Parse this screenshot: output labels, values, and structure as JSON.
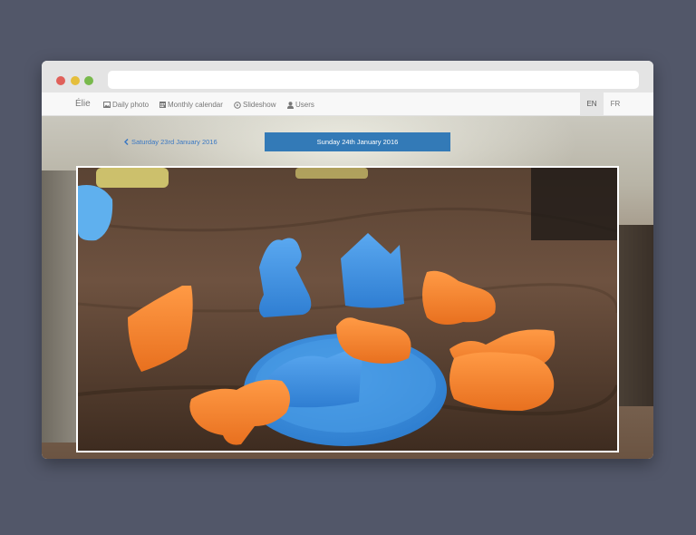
{
  "browser": {
    "url": ""
  },
  "navbar": {
    "brand": "Élie",
    "items": [
      {
        "label": "Daily photo",
        "icon": "image-icon"
      },
      {
        "label": "Monthly calendar",
        "icon": "calendar-icon"
      },
      {
        "label": "Slideshow",
        "icon": "play-circle-icon"
      },
      {
        "label": "Users",
        "icon": "user-icon"
      }
    ],
    "languages": [
      {
        "label": "EN",
        "active": true
      },
      {
        "label": "FR",
        "active": false
      }
    ]
  },
  "day_nav": {
    "previous_label": "Saturday 23rd January 2016",
    "current_label": "Sunday 24th January 2016"
  },
  "photo": {
    "alt": "Play-dough animal shapes on a wooden table"
  },
  "colors": {
    "accent": "#337ab7",
    "link": "#3a78c3",
    "page_background": "#525769"
  }
}
